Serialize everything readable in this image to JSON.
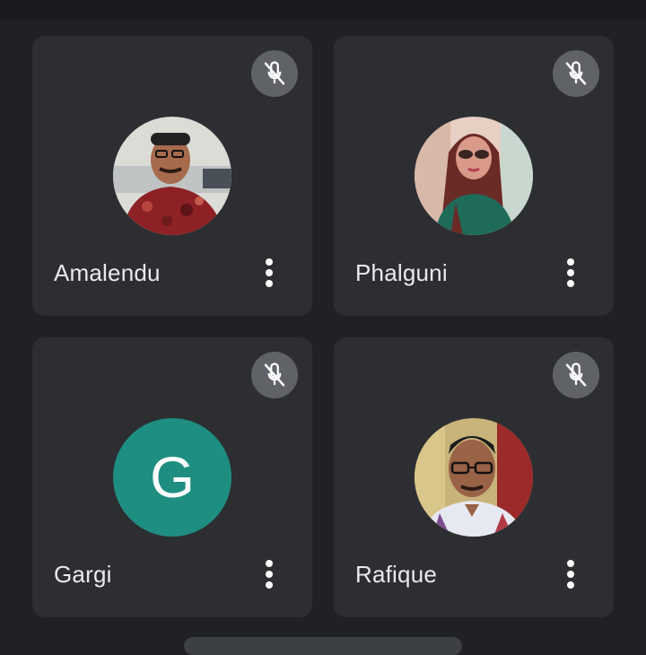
{
  "participants": [
    {
      "name": "Amalendu",
      "muted": true,
      "avatar": "photo",
      "avatar_icon": "man-with-glasses-photo"
    },
    {
      "name": "Phalguni",
      "muted": true,
      "avatar": "photo",
      "avatar_icon": "woman-with-sunglasses-photo"
    },
    {
      "name": "Gargi",
      "muted": true,
      "avatar": "initial",
      "initial": "G",
      "avatar_color": "#1e8e80"
    },
    {
      "name": "Rafique",
      "muted": true,
      "avatar": "photo",
      "avatar_icon": "man-with-glasses-photo"
    }
  ],
  "icons": {
    "mute": "microphone-off-icon",
    "more": "more-vertical-icon"
  },
  "colors": {
    "background": "#202124",
    "tile": "#2d2e31",
    "mute_badge": "#5f6368",
    "text": "#e8eaed"
  }
}
